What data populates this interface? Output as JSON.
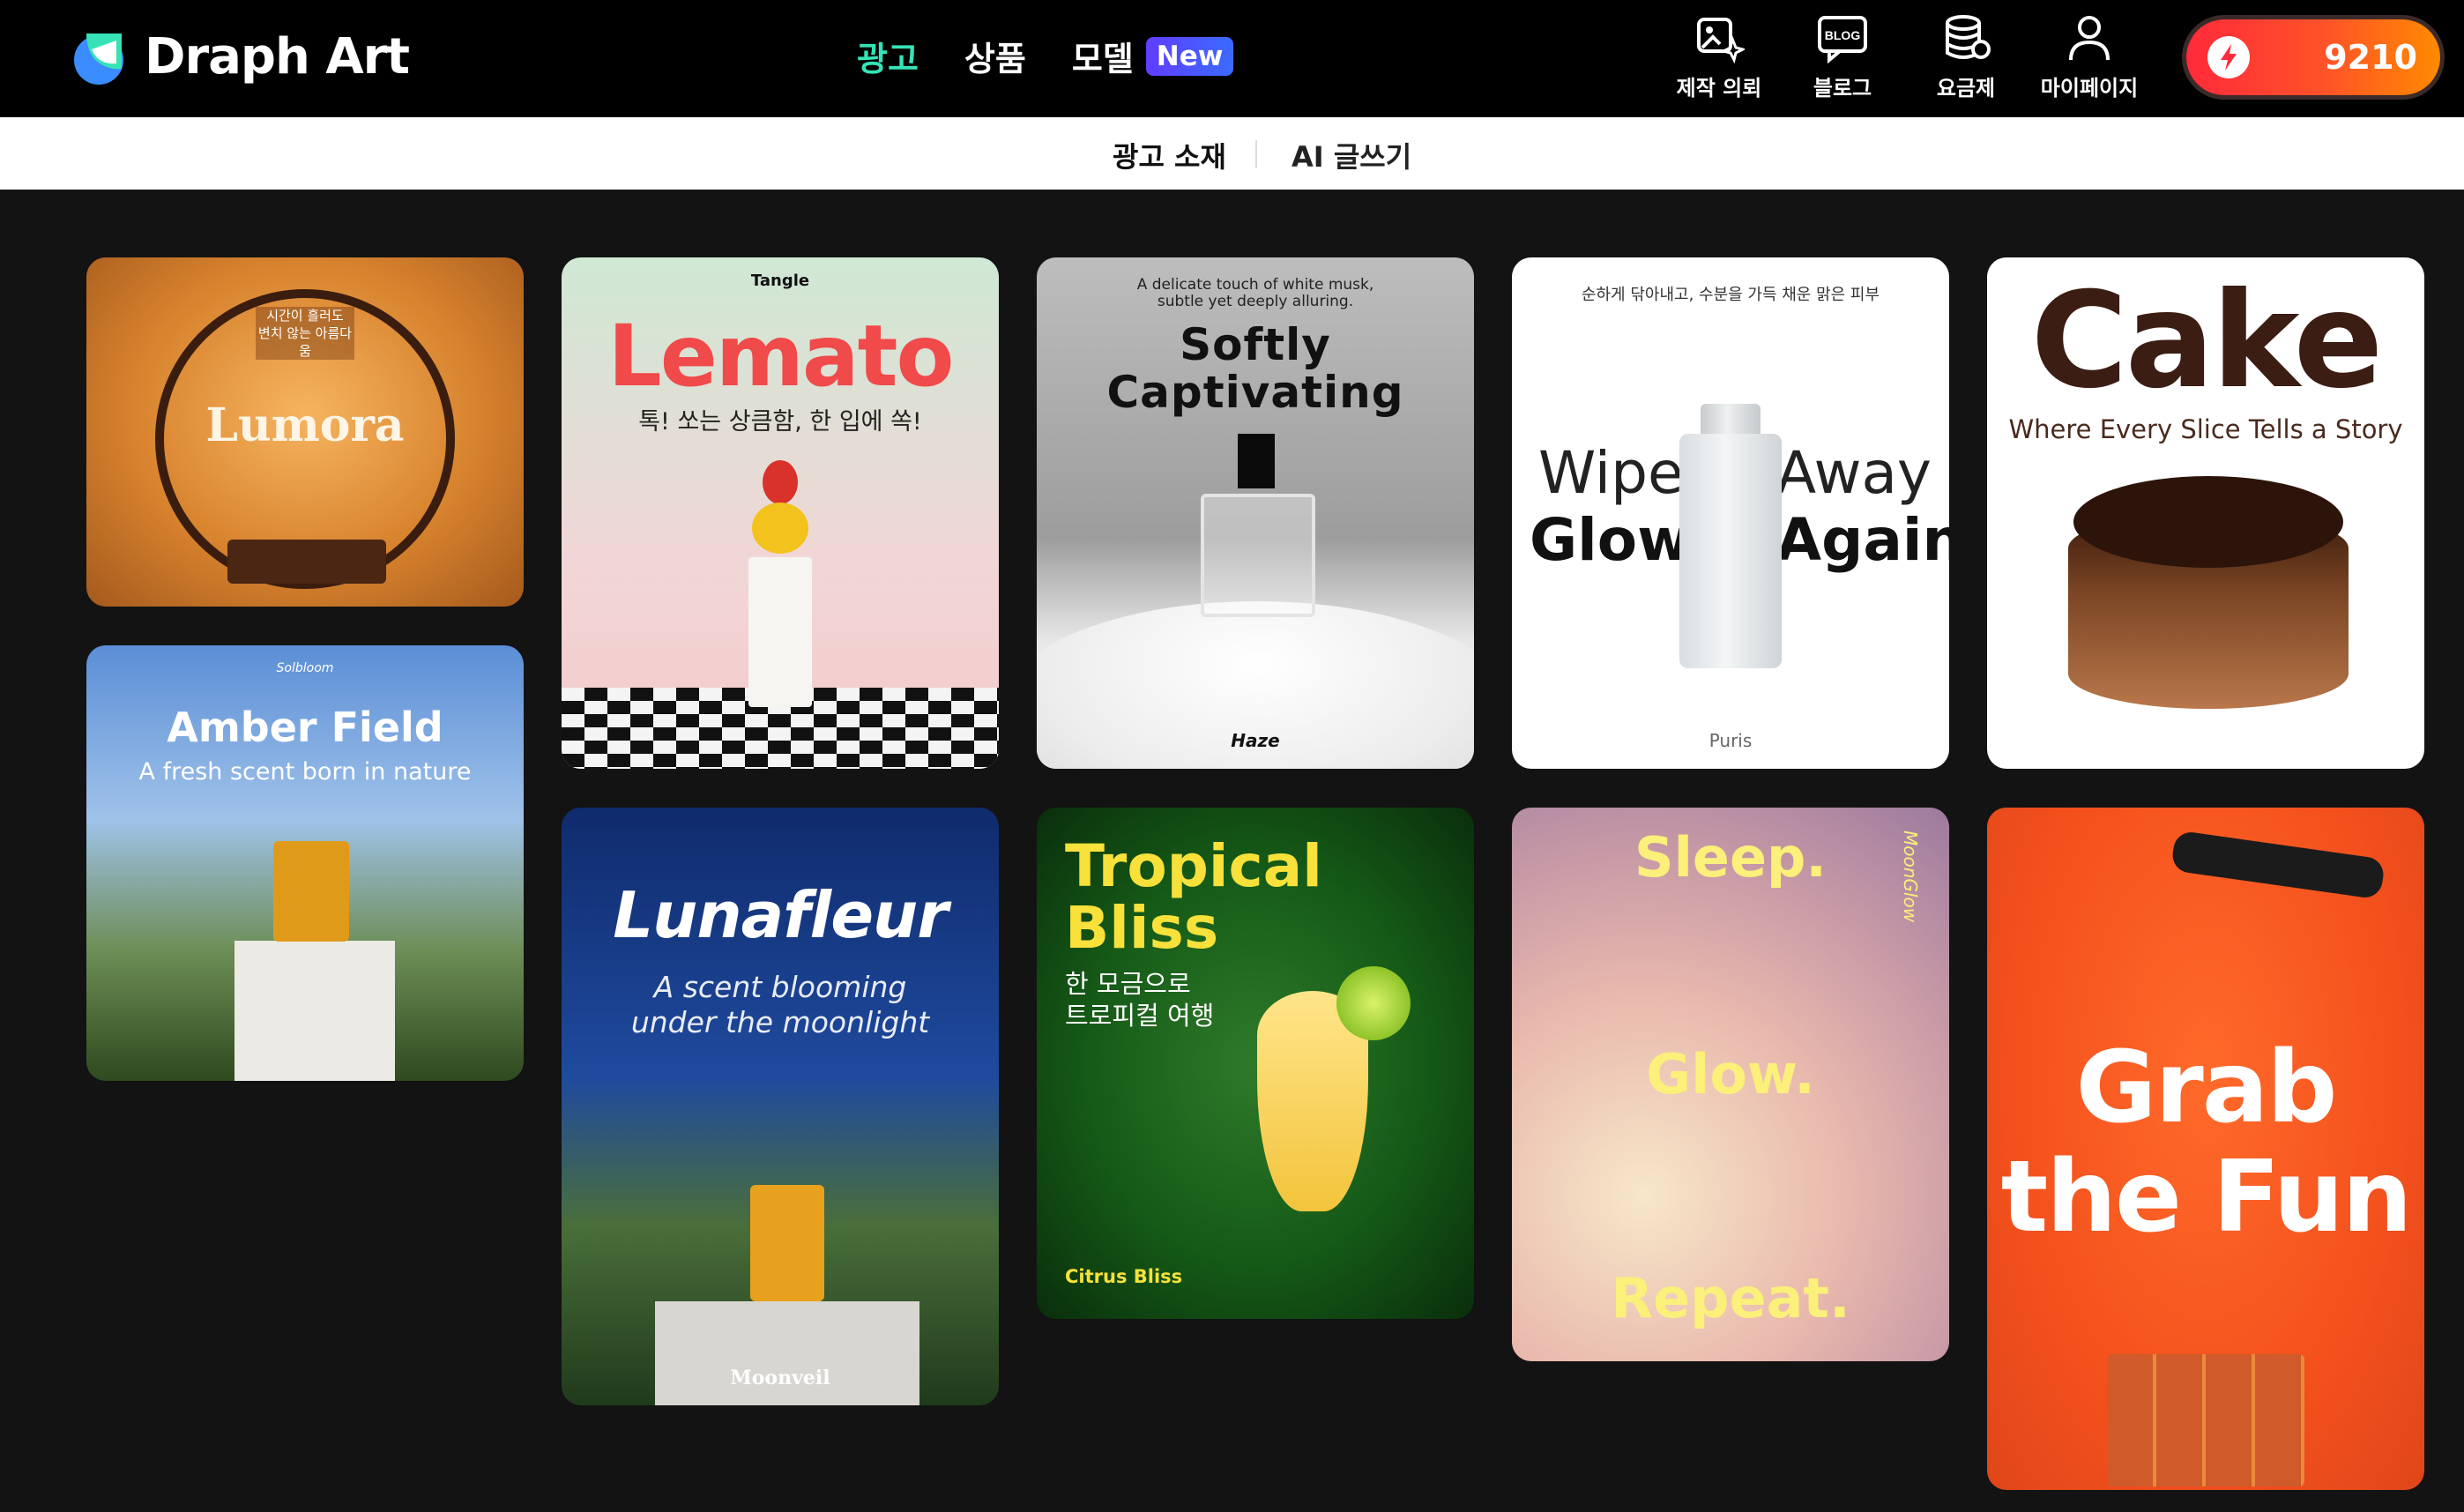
{
  "header": {
    "logo_text": "Draph Art",
    "nav": [
      {
        "label": "광고",
        "active": true
      },
      {
        "label": "상품",
        "active": false
      },
      {
        "label": "모델",
        "active": false,
        "badge": "New"
      }
    ],
    "right_items": [
      {
        "label": "제작 의뢰",
        "icon": "request-icon"
      },
      {
        "label": "블로그",
        "icon": "blog-icon",
        "icon_text": "BLOG"
      },
      {
        "label": "요금제",
        "icon": "pricing-icon"
      },
      {
        "label": "마이페이지",
        "icon": "user-icon"
      }
    ],
    "credits": "9210",
    "accent_color": "#35e3b6"
  },
  "subnav": {
    "tabs": [
      {
        "label": "광고 소재",
        "active": true
      },
      {
        "label": "AI 글쓰기",
        "active": false
      }
    ]
  },
  "gallery": {
    "lumora": {
      "title": "Lumora",
      "tagline_line1": "시간이 흘러도",
      "tagline_line2": "변치 않는 아름다움"
    },
    "amber": {
      "brand": "Solbloom",
      "title": "Amber Field",
      "subtitle": "A fresh scent born in nature"
    },
    "lemato": {
      "brand": "Tangle",
      "title": "Lemato",
      "subtitle": "톡! 쏘는 상큼함, 한 입에 쏙!"
    },
    "lunafleur": {
      "title": "Lunafleur",
      "subtitle_line1": "A scent blooming",
      "subtitle_line2": "under the moonlight",
      "brand": "Moonveil"
    },
    "softly": {
      "tagline_line1": "A delicate touch of white musk,",
      "tagline_line2": "subtle yet deeply alluring.",
      "title_line1": "Softly",
      "title_line2": "Captivating",
      "brand": "Haze"
    },
    "tropical": {
      "title_line1": "Tropical",
      "title_line2": "Bliss",
      "subtitle_line1": "한 모금으로",
      "subtitle_line2": "트로피컬 여행",
      "brand": "Citrus Bliss"
    },
    "wipe": {
      "tagline": "순하게 닦아내고, 수분을 가득 채운 맑은 피부",
      "word1": "Wipe",
      "word2": "Away",
      "word3": "Glow",
      "word4": "Again",
      "brand": "Puris"
    },
    "sleep": {
      "word1": "Sleep.",
      "word2": "Glow.",
      "word3": "Repeat.",
      "brand": "MoonGlow"
    },
    "cake": {
      "title": "Cake",
      "subtitle": "Where Every Slice Tells a Story"
    },
    "grab": {
      "title_line1": "Grab",
      "title_line2": "the Fun"
    }
  }
}
